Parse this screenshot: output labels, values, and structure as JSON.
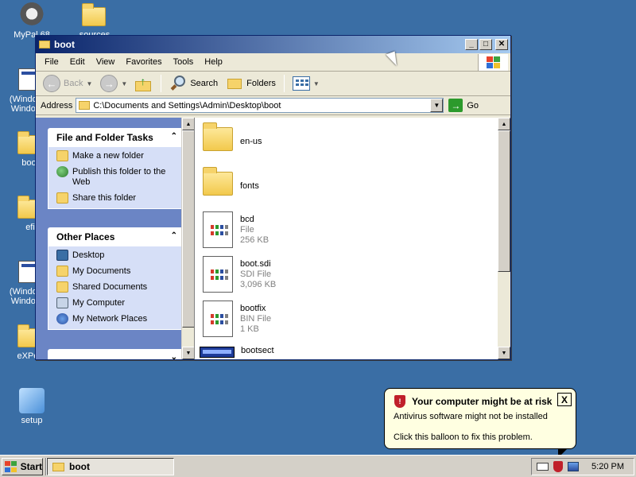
{
  "desktop": {
    "icons": [
      {
        "label": "MyPal 68"
      },
      {
        "label": "sources"
      },
      {
        "label": "(Windows Windows"
      },
      {
        "label": "boot"
      },
      {
        "label": "efi"
      },
      {
        "label": "(Windows Windows"
      },
      {
        "label": "eXPeri"
      },
      {
        "label": "setup"
      }
    ]
  },
  "window": {
    "title": "boot",
    "buttons": {
      "minimize": "_",
      "maximize": "□",
      "close": "✕"
    },
    "menu": [
      "File",
      "Edit",
      "View",
      "Favorites",
      "Tools",
      "Help"
    ],
    "toolbar": {
      "back": "Back",
      "search": "Search",
      "folders": "Folders"
    },
    "address": {
      "label": "Address",
      "value": "C:\\Documents and Settings\\Admin\\Desktop\\boot",
      "go": "Go"
    },
    "tasks": {
      "file_folder_title": "File and Folder Tasks",
      "file_folder_items": [
        "Make a new folder",
        "Publish this folder to the Web",
        "Share this folder"
      ],
      "other_places_title": "Other Places",
      "other_places_items": [
        "Desktop",
        "My Documents",
        "Shared Documents",
        "My Computer",
        "My Network Places"
      ]
    },
    "files": [
      {
        "name": "en-us"
      },
      {
        "name": "fonts"
      },
      {
        "name": "bcd",
        "type": "File",
        "size": "256 KB"
      },
      {
        "name": "boot.sdi",
        "type": "SDI File",
        "size": "3,096 KB"
      },
      {
        "name": "bootfix",
        "type": "BIN File",
        "size": "1 KB"
      },
      {
        "name": "bootsect"
      }
    ]
  },
  "balloon": {
    "title": "Your computer might be at risk",
    "message": "Antivirus software might not be installed",
    "hint": "Click this balloon to fix this problem.",
    "close": "X"
  },
  "taskbar": {
    "start": "Start",
    "task": "boot",
    "clock": "5:20 PM"
  },
  "colors": {
    "desktop": "#3a6ea5",
    "titlebar_start": "#0a246a",
    "titlebar_end": "#a6caf0",
    "task_pane": "#6b85c5",
    "balloon": "#ffffe1"
  }
}
